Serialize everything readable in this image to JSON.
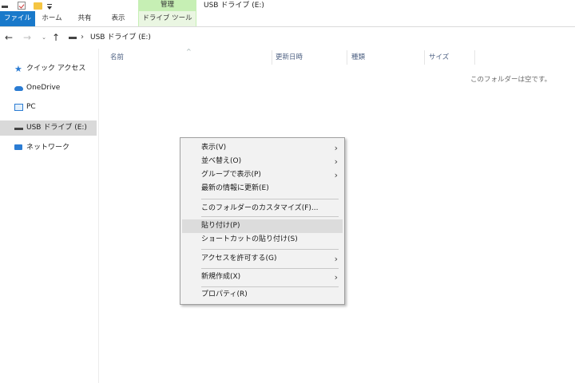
{
  "window": {
    "title": "USB ドライブ (E:)",
    "manage_tab": "管理"
  },
  "ribbon": {
    "tabs": [
      "ファイル",
      "ホーム",
      "共有",
      "表示",
      "ドライブ ツール"
    ]
  },
  "address": {
    "path": "USB ドライブ (E:)",
    "separator": "›",
    "back_icon": "←",
    "forward_icon": "→",
    "recent_icon": "⌄",
    "up_icon": "↑"
  },
  "navpane": {
    "items": [
      {
        "label": "クイック アクセス",
        "icon": "star-icon"
      },
      {
        "label": "OneDrive",
        "icon": "cloud-icon"
      },
      {
        "label": "PC",
        "icon": "computer-icon"
      },
      {
        "label": "USB ドライブ (E:)",
        "icon": "usb-drive-icon",
        "selected": true
      },
      {
        "label": "ネットワーク",
        "icon": "network-icon"
      }
    ]
  },
  "columns": {
    "name": "名前",
    "date": "更新日時",
    "type": "種類",
    "size": "サイズ",
    "sort_caret": "^"
  },
  "content": {
    "empty_message": "このフォルダーは空です。"
  },
  "context_menu": {
    "chevron": "›",
    "items": [
      {
        "label": "表示(V)",
        "submenu": true
      },
      {
        "label": "並べ替え(O)",
        "submenu": true
      },
      {
        "label": "グループで表示(P)",
        "submenu": true
      },
      {
        "label": "最新の情報に更新(E)",
        "submenu": false
      },
      {
        "label": "このフォルダーのカスタマイズ(F)...",
        "submenu": false
      },
      {
        "label": "貼り付け(P)",
        "submenu": false,
        "highlighted": true
      },
      {
        "label": "ショートカットの貼り付け(S)",
        "submenu": false
      },
      {
        "label": "アクセスを許可する(G)",
        "submenu": true
      },
      {
        "label": "新規作成(X)",
        "submenu": true
      },
      {
        "label": "プロパティ(R)",
        "submenu": false
      }
    ]
  },
  "colors": {
    "file_tab": "#1979ca",
    "manage_tag": "#c6efb4",
    "selection": "#d9d9d9",
    "menu_bg": "#f2f2f2"
  }
}
